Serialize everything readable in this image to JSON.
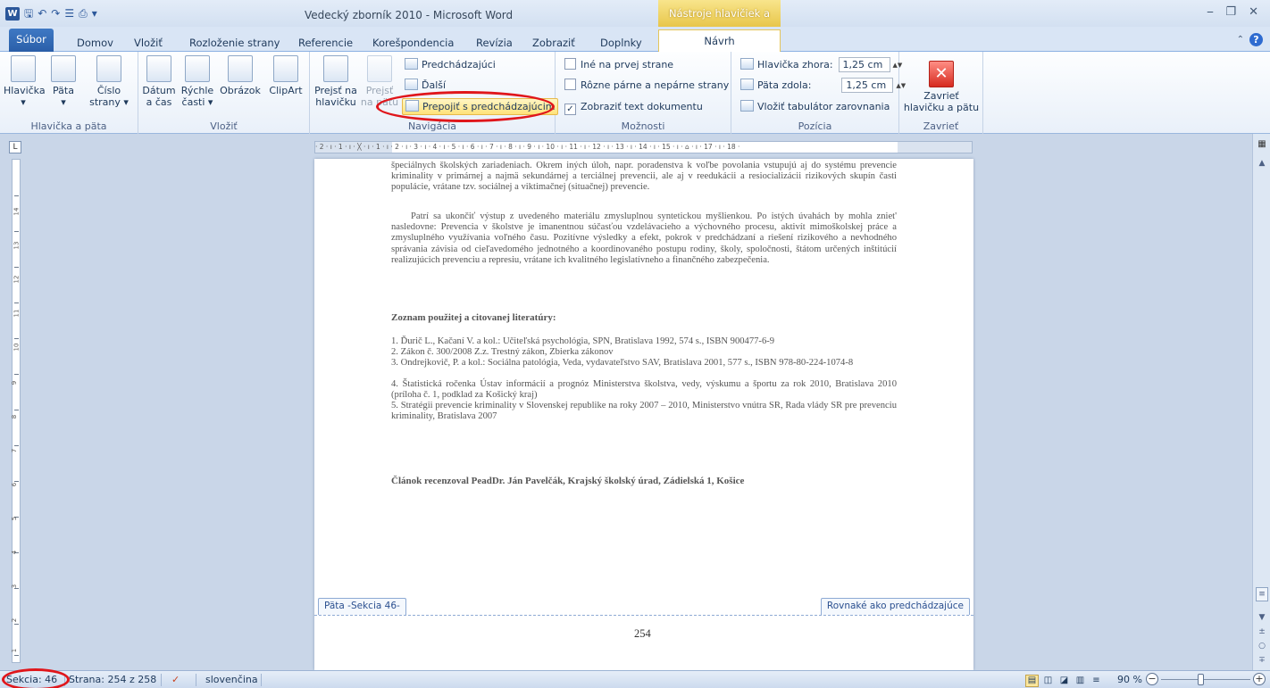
{
  "titlebar": {
    "window_title": "Vedecký zborník 2010 - Microsoft Word",
    "context_title": "Nástroje hlavičiek a piat",
    "qat_icons": [
      "word-logo",
      "save-icon",
      "undo-icon",
      "redo-icon",
      "layout-icon",
      "print-icon",
      "customize-icon"
    ],
    "qat_glyphs": {
      "logo": "W",
      "save": "🖫",
      "undo": "↶",
      "redo": "↷",
      "layout": "☰",
      "print": "⎙",
      "more": "▾"
    },
    "window_controls": "⎯ ❐ ✕"
  },
  "tabs": {
    "file": "Súbor",
    "items": [
      "Domov",
      "Vložiť",
      "Rozloženie strany",
      "Referencie",
      "Korešpondencia",
      "Revízia",
      "Zobraziť",
      "Doplnky"
    ],
    "active": "Návrh"
  },
  "ribbon": {
    "header_footer_group": {
      "label": "Hlavička a päta",
      "header": "Hlavička",
      "header_arrow": "▾",
      "footer": "Päta",
      "footer_arrow": "▾",
      "page_number": "Číslo",
      "page_number_2": "strany ▾"
    },
    "insert_group": {
      "label": "Vložiť",
      "date": "Dátum",
      "date_2": "a čas",
      "quick_parts": "Rýchle",
      "quick_parts_2": "časti ▾",
      "picture": "Obrázok",
      "clipart": "ClipArt"
    },
    "navigation_group": {
      "label": "Navigácia",
      "goto_header": "Prejsť na",
      "goto_header_2": "hlavičku",
      "goto_footer": "Prejsť",
      "goto_footer_2": "na pätu",
      "previous": "Predchádzajúci",
      "next": "Ďalší",
      "link_previous": "Prepojiť s predchádzajúcim"
    },
    "options_group": {
      "label": "Možnosti",
      "diff_first": "Iné na prvej strane",
      "diff_odd_even": "Rôzne párne a nepárne strany",
      "show_text": "Zobraziť text dokumentu",
      "show_text_checked": "✓"
    },
    "position_group": {
      "label": "Pozícia",
      "header_top": "Hlavička zhora:",
      "header_top_value": "1,25 cm",
      "footer_bottom": "Päta zdola:",
      "footer_bottom_value": "1,25 cm",
      "insert_tab": "Vložiť tabulátor zarovnania",
      "spin": "▲▼"
    },
    "close_group": {
      "label": "Zavrieť",
      "close": "Zavrieť",
      "close_2": "hlavičku a pätu",
      "close_glyph": "✕"
    }
  },
  "ruler": {
    "corner": "L",
    "horizontal": "· 2 · ı · 1 · ı · ╳ · ı · 1 · ı · 2 · ı · 3 · ı · 4 · ı · 5 · ı · 6 · ı · 7 · ı · 8 · ı · 9 · ı · 10 · ı · 11 · ı · 12 · ı · 13 · ı · 14 · ı · 15 · ı · ⌂ · ı · 17 · ı · 18 ·",
    "vertical_numbers": [
      "14",
      "13",
      "12",
      "11",
      "10",
      "9",
      "8",
      "7",
      "6",
      "5",
      "4",
      "3",
      "2",
      "1"
    ]
  },
  "document": {
    "para1": "špeciálnych školských zariadeniach. Okrem iných úloh, napr. poradenstva k voľbe povolania vstupujú aj do systému prevencie kriminality v primárnej a najmä sekundárnej a terciálnej prevencii, ale aj v reedukácii a resiocializácii rizikových skupín časti populácie, vrátane tzv. sociálnej a viktimačnej (situačnej) prevencie.",
    "para2": "Patrí sa ukončiť výstup z uvedeného materiálu zmysluplnou syntetickou myšlienkou. Po istých úvahách by mohla zniet' nasledovne: Prevencia v školstve je imanentnou súčasťou vzdelávacieho a výchovného procesu, aktivít mimoškolskej práce a zmysluplného využívania voľného času. Pozitívne výsledky a efekt, pokrok v predchádzaní a riešení rizikového a nevhodného správania závisia od cieľavedomého jednotného a koordinovaného postupu rodiny, školy, spoločnosti, štátom určených inštitúcií realizujúcich prevenciu a represiu, vrátane ich kvalitného legislatívneho a finančného zabezpečenia.",
    "refs_heading": "Zoznam použitej a citovanej literatúry:",
    "refs": [
      "1. Ďurič L., Kačaní V. a kol.: Učiteľská psychológia, SPN, Bratislava 1992, 574 s., ISBN 900477-6-9",
      "2. Zákon č. 300/2008 Z.z. Trestný zákon, Zbierka zákonov",
      "3. Ondrejkovič, P. a kol.: Sociálna patológia, Veda, vydavateľstvo SAV, Bratislava 2001, 577 s., ISBN 978-80-224-1074-8",
      "4. Štatistická ročenka Ústav informácií a prognóz Ministerstva školstva, vedy, výskumu a športu za rok 2010, Bratislava 2010 (príloha č. 1, podklad za Košický kraj)",
      "5. Stratégii prevencie kriminality v Slovenskej republike na roky 2007 – 2010, Ministerstvo vnútra SR, Rada vlády SR pre prevenciu kriminality, Bratislava 2007"
    ],
    "reviewer": "Článok recenzoval PeadDr. Ján Pavelčák, Krajský školský úrad, Zádielská 1, Košice",
    "footer_tag_left": "Päta -Sekcia 46-",
    "footer_tag_right": "Rovnaké ako predchádzajúce",
    "page_number": "254"
  },
  "statusbar": {
    "section": "Sekcia: 46",
    "page": "Strana: 254 z 258",
    "proof_icon": "✓",
    "language": "slovenčina",
    "zoom": "90 %",
    "zoom_level_percent": 90,
    "zoom_minus": "−",
    "zoom_plus": "+",
    "view_glyphs": [
      "▤",
      "◫",
      "◪",
      "▥",
      "≡"
    ]
  },
  "scrollbar": {
    "up": "▲",
    "down": "▼",
    "prev": "±",
    "select": "○",
    "next": "∓",
    "split": "≡"
  }
}
